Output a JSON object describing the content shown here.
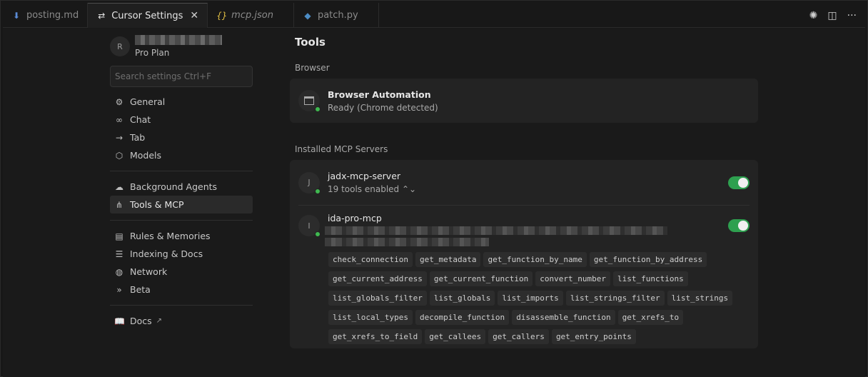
{
  "tabs": [
    {
      "label": "posting.md",
      "icon": "markdown-icon",
      "active": false,
      "italic": false
    },
    {
      "label": "Cursor Settings",
      "icon": "settings-sliders-icon",
      "active": true,
      "italic": false
    },
    {
      "label": "mcp.json",
      "icon": "json-icon",
      "active": false,
      "italic": true
    },
    {
      "label": "patch.py",
      "icon": "python-icon",
      "active": false,
      "italic": false
    }
  ],
  "user": {
    "avatar_letter": "R",
    "plan": "Pro Plan"
  },
  "search": {
    "placeholder": "Search settings Ctrl+F"
  },
  "nav": {
    "group1": [
      {
        "label": "General",
        "icon": "gear-icon"
      },
      {
        "label": "Chat",
        "icon": "infinity-icon"
      },
      {
        "label": "Tab",
        "icon": "arrow-right-icon"
      },
      {
        "label": "Models",
        "icon": "cube-icon"
      }
    ],
    "group2": [
      {
        "label": "Background Agents",
        "icon": "cloud-icon"
      },
      {
        "label": "Tools & MCP",
        "icon": "nodes-icon"
      }
    ],
    "group3": [
      {
        "label": "Rules & Memories",
        "icon": "clipboard-icon"
      },
      {
        "label": "Indexing & Docs",
        "icon": "database-icon"
      },
      {
        "label": "Network",
        "icon": "globe-icon"
      },
      {
        "label": "Beta",
        "icon": "double-chevron-icon"
      }
    ],
    "docs": {
      "label": "Docs",
      "icon": "book-icon"
    }
  },
  "content": {
    "title": "Tools",
    "browser_label": "Browser",
    "browser": {
      "name": "Browser Automation",
      "status": "Ready (Chrome detected)"
    },
    "mcp_label": "Installed MCP Servers",
    "servers": [
      {
        "letter": "J",
        "name": "jadx-mcp-server",
        "sub": "19 tools enabled ⌃⌄"
      },
      {
        "letter": "I",
        "name": "ida-pro-mcp"
      }
    ],
    "tools": [
      "check_connection",
      "get_metadata",
      "get_function_by_name",
      "get_function_by_address",
      "get_current_address",
      "get_current_function",
      "convert_number",
      "list_functions",
      "list_globals_filter",
      "list_globals",
      "list_imports",
      "list_strings_filter",
      "list_strings",
      "list_local_types",
      "decompile_function",
      "disassemble_function",
      "get_xrefs_to",
      "get_xrefs_to_field",
      "get_callees",
      "get_callers",
      "get_entry_points"
    ]
  },
  "colors": {
    "accent_green": "#2ea04f",
    "status_dot": "#3fb950",
    "background": "#181818"
  }
}
